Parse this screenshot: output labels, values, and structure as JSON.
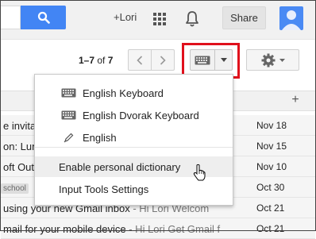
{
  "header": {
    "user_link": "+Lori",
    "share_label": "Share",
    "search_icon": "search-icon",
    "apps_icon": "apps-grid-icon",
    "bell_icon": "notifications-bell-icon",
    "accent": "#4285f4"
  },
  "toolbar": {
    "range": "1–7",
    "of": "of",
    "total": "7",
    "prev": "‹",
    "next": "›",
    "highlight_color": "#e0101c"
  },
  "list": {
    "add_tab": "+",
    "rows": [
      {
        "subject": "e invitati",
        "snippet": "",
        "label": "",
        "date": "Nov 18"
      },
      {
        "subject": "on: Lunc",
        "snippet": "",
        "label": "",
        "date": "Nov 15"
      },
      {
        "subject": "oft Outlo",
        "snippet": "",
        "label": "",
        "date": "Nov 10"
      },
      {
        "subject": "",
        "snippet": "",
        "label": "school",
        "date": "Oct 30"
      },
      {
        "subject": "using your new Gmail inbox",
        "snippet": " - Hi Lori Welcom",
        "label": "",
        "date": "Oct 21"
      },
      {
        "subject": "mail for your mobile device",
        "snippet": " - Hi Lori Get Gmail f",
        "label": "",
        "date": "Oct 21"
      }
    ]
  },
  "menu": {
    "items": [
      {
        "label": "English Keyboard",
        "icon": "keyboard-icon"
      },
      {
        "label": "English Dvorak Keyboard",
        "icon": "keyboard-icon"
      },
      {
        "label": "English",
        "icon": "pencil-icon"
      },
      {
        "label": "Enable personal dictionary",
        "icon": ""
      },
      {
        "label": "Input Tools Settings",
        "icon": ""
      }
    ]
  }
}
